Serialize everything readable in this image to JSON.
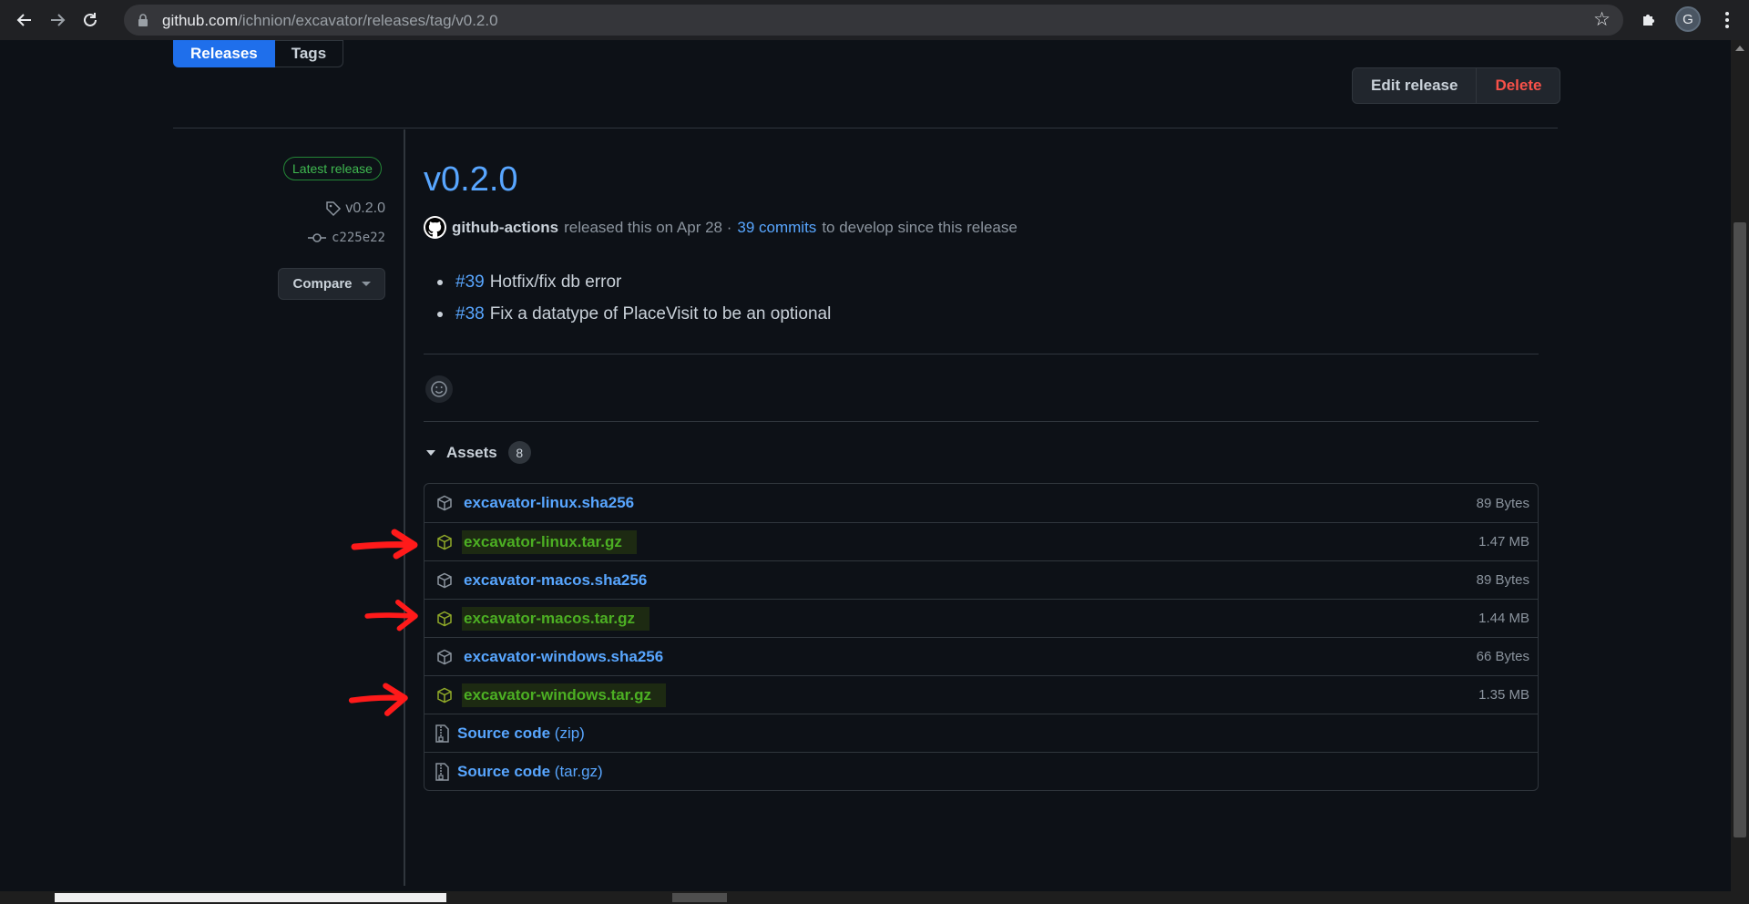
{
  "browser": {
    "url_host": "github.com",
    "url_path": "/ichnion/excavator/releases/tag/v0.2.0",
    "profile_initial": "G"
  },
  "subnav": {
    "releases": "Releases",
    "tags": "Tags"
  },
  "actions": {
    "edit": "Edit release",
    "delete": "Delete"
  },
  "sidebar": {
    "latest_badge": "Latest release",
    "tag": "v0.2.0",
    "commit": "c225e22",
    "compare": "Compare"
  },
  "release": {
    "title": "v0.2.0",
    "author": "github-actions",
    "released_text": "released this on Apr 28 ·",
    "commits_link": "39 commits",
    "since_text": "to develop since this release",
    "notes": [
      {
        "pr": "#39",
        "text": "Hotfix/fix db error"
      },
      {
        "pr": "#38",
        "text": "Fix a datatype of PlaceVisit to be an optional"
      }
    ]
  },
  "assets": {
    "label": "Assets",
    "count": "8",
    "items": [
      {
        "name": "excavator-linux.sha256",
        "size": "89 Bytes",
        "highlighted": false
      },
      {
        "name": "excavator-linux.tar.gz",
        "size": "1.47 MB",
        "highlighted": true
      },
      {
        "name": "excavator-macos.sha256",
        "size": "89 Bytes",
        "highlighted": false
      },
      {
        "name": "excavator-macos.tar.gz",
        "size": "1.44 MB",
        "highlighted": true
      },
      {
        "name": "excavator-windows.sha256",
        "size": "66 Bytes",
        "highlighted": false
      },
      {
        "name": "excavator-windows.tar.gz",
        "size": "1.35 MB",
        "highlighted": true
      }
    ],
    "source": [
      {
        "name": "Source code",
        "suffix": "(zip)"
      },
      {
        "name": "Source code",
        "suffix": "(tar.gz)"
      }
    ]
  },
  "colors": {
    "accent": "#58a6ff",
    "delete": "#f85149",
    "highlight": "#4caf23",
    "annotation": "#ff1a1a"
  }
}
